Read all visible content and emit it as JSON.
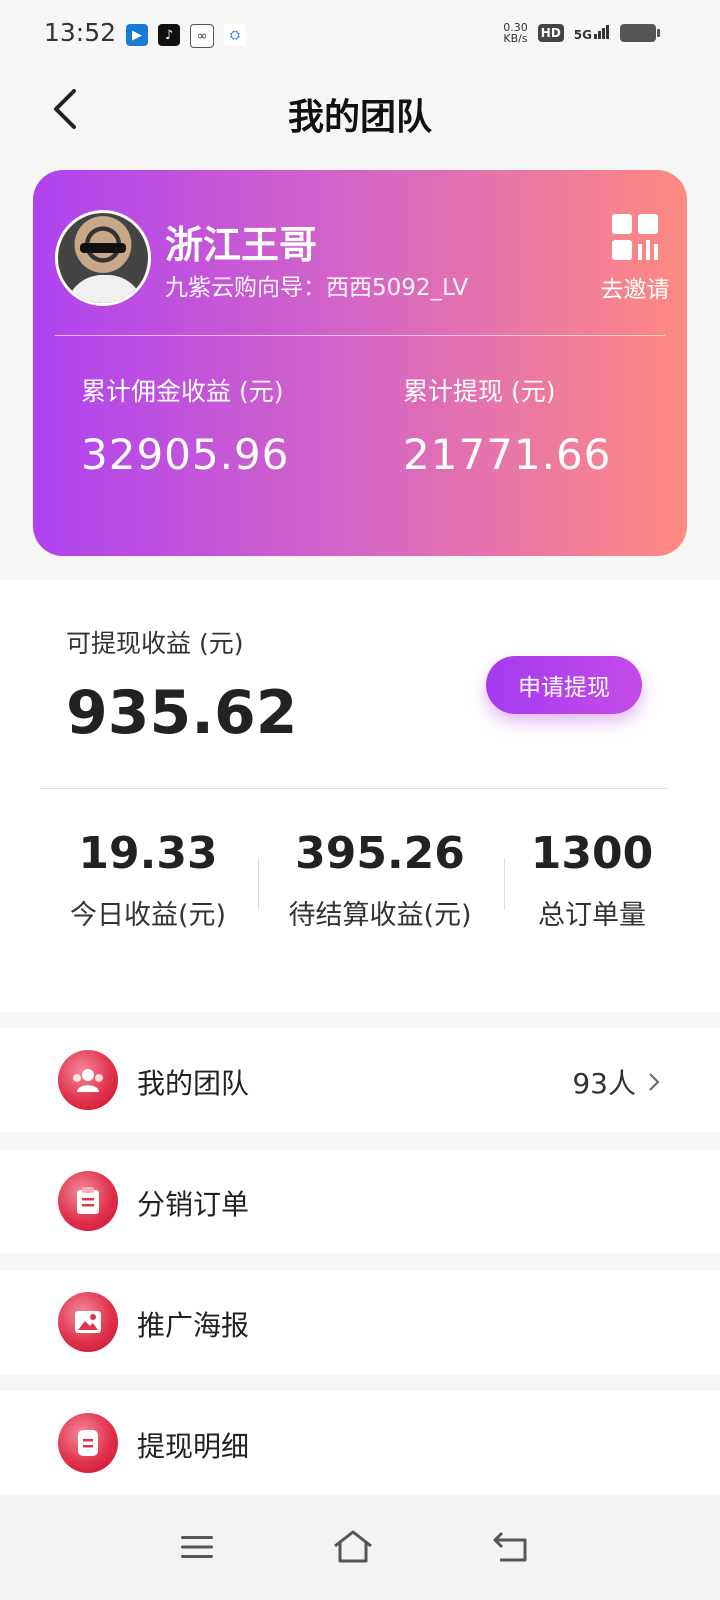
{
  "status_bar": {
    "time": "13:52",
    "net_speed_value": "0.30",
    "net_speed_unit": "KB/s",
    "hd": "HD",
    "network": "5G"
  },
  "header": {
    "title": "我的团队",
    "back_icon": "chevron-left-icon"
  },
  "profile": {
    "name": "浙江王哥",
    "subtitle": "九紫云购向导：西西5092_LV",
    "invite_label": "去邀请",
    "stats": [
      {
        "label": "累计佣金收益 (元)",
        "value": "32905.96"
      },
      {
        "label": "累计提现 (元)",
        "value": "21771.66"
      }
    ],
    "gradient_colors": [
      "#b042f0",
      "#ff8a80"
    ]
  },
  "earnings": {
    "available_label": "可提现收益 (元)",
    "available_value": "935.62",
    "withdraw_button": "申请提现",
    "stats": [
      {
        "value": "19.33",
        "label": "今日收益(元)"
      },
      {
        "value": "395.26",
        "label": "待结算收益(元)"
      },
      {
        "value": "1300",
        "label": "总订单量"
      }
    ]
  },
  "menu": [
    {
      "label": "我的团队",
      "value": "93人",
      "icon": "team-icon"
    },
    {
      "label": "分销订单",
      "value": "",
      "icon": "order-icon"
    },
    {
      "label": "推广海报",
      "value": "",
      "icon": "image-icon"
    },
    {
      "label": "提现明细",
      "value": "",
      "icon": "document-icon"
    }
  ],
  "accent_color": "#e0324b"
}
